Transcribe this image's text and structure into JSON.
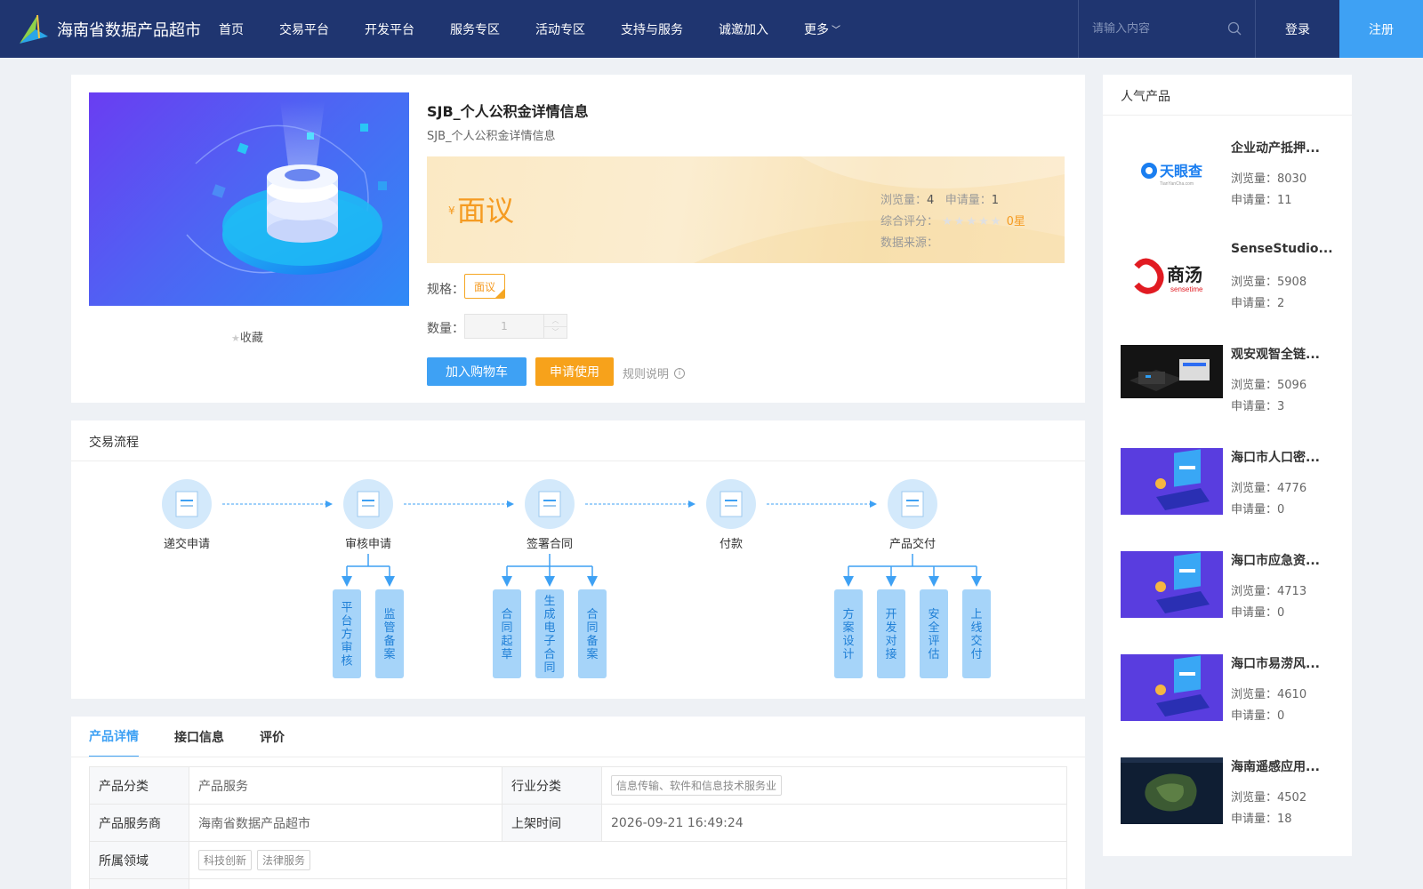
{
  "nav": {
    "logo_text": "海南省数据产品超市",
    "menu": [
      {
        "label": "首页"
      },
      {
        "label": "交易平台"
      },
      {
        "label": "开发平台"
      },
      {
        "label": "服务专区"
      },
      {
        "label": "活动专区"
      },
      {
        "label": "支持与服务"
      },
      {
        "label": "诚邀加入"
      },
      {
        "label": "更多"
      }
    ],
    "search_placeholder": "请输入内容",
    "login": "登录",
    "register": "注册"
  },
  "product": {
    "title": "SJB_个人公积金详情信息",
    "subtitle": "SJB_个人公积金详情信息",
    "price_symbol": "¥",
    "price": "面议",
    "views_label": "浏览量：",
    "views": "4",
    "applies_label": "申请量：",
    "applies": "1",
    "rating_label": "综合评分：",
    "rating_stars": 0,
    "rating_text": "0星",
    "source_label": "数据来源：",
    "spec_label": "规格：",
    "spec_value": "面议",
    "qty_label": "数量：",
    "qty_value": "1",
    "favorite": "收藏",
    "add_cart": "加入购物车",
    "apply": "申请使用",
    "rules": "规则说明"
  },
  "process": {
    "title": "交易流程",
    "steps": [
      {
        "label": "递交申请",
        "subs": []
      },
      {
        "label": "审核申请",
        "subs": [
          "平台方审核",
          "监管备案"
        ]
      },
      {
        "label": "签署合同",
        "subs": [
          "合同起草",
          "生成电子合同",
          "合同备案"
        ]
      },
      {
        "label": "付款",
        "subs": []
      },
      {
        "label": "产品交付",
        "subs": [
          "方案设计",
          "开发对接",
          "安全评估",
          "上线交付"
        ]
      }
    ]
  },
  "detail": {
    "tabs": [
      {
        "label": "产品详情"
      },
      {
        "label": "接口信息"
      },
      {
        "label": "评价"
      }
    ],
    "rows": {
      "category_k": "产品分类",
      "category_v": "产品服务",
      "industry_k": "行业分类",
      "industry_v": "信息传输、软件和信息技术服务业",
      "provider_k": "产品服务商",
      "provider_v": "海南省数据产品超市",
      "time_k": "上架时间",
      "time_v": "2026-09-21 16:49:24",
      "domain_k": "所属领域",
      "domain_tags": [
        "科技创新",
        "法律服务"
      ]
    }
  },
  "sidebar": {
    "title": "人气产品",
    "items": [
      {
        "name": "企业动产抵押...",
        "views": "浏览量：8030",
        "applies": "申请量：11",
        "thumb": "tianyancha-logo",
        "thumb_text": "天眼查",
        "thumb_sub": "TianYanCha.com"
      },
      {
        "name": "SenseStudio...",
        "views": "浏览量：5908",
        "applies": "申请量：2",
        "thumb": "sensetime-logo",
        "thumb_text": "商汤",
        "thumb_sub": "sensetime"
      },
      {
        "name": "观安观智全链...",
        "views": "浏览量：5096",
        "applies": "申请量：3",
        "thumb": "dark-device"
      },
      {
        "name": "海口市人口密...",
        "views": "浏览量：4776",
        "applies": "申请量：0",
        "thumb": "purple-laptop"
      },
      {
        "name": "海口市应急资...",
        "views": "浏览量：4713",
        "applies": "申请量：0",
        "thumb": "purple-laptop"
      },
      {
        "name": "海口市易涝风...",
        "views": "浏览量：4610",
        "applies": "申请量：0",
        "thumb": "purple-laptop"
      },
      {
        "name": "海南遥感应用...",
        "views": "浏览量：4502",
        "applies": "申请量：18",
        "thumb": "satellite-map"
      }
    ]
  },
  "colors": {
    "nav_bg": "#1f3570",
    "primary": "#3ea1f4",
    "orange": "#f7a21b",
    "price": "#f59b22"
  }
}
